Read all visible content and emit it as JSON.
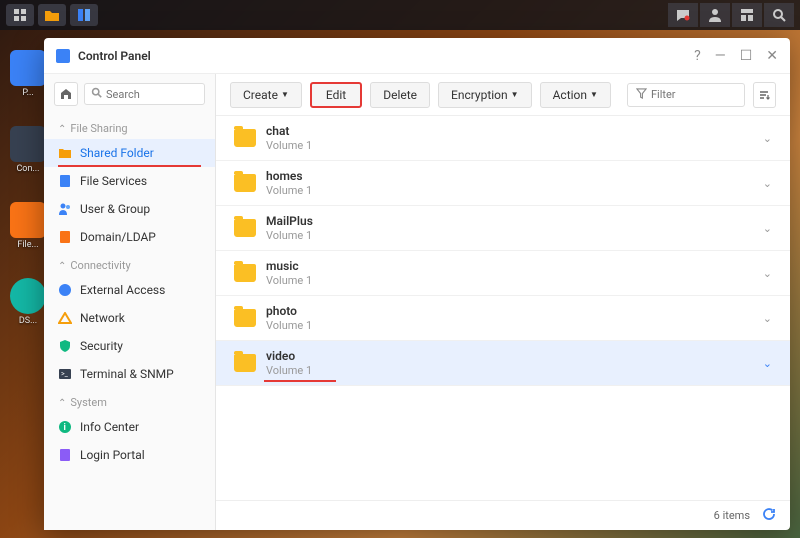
{
  "window": {
    "title": "Control Panel"
  },
  "search": {
    "placeholder": "Search"
  },
  "sidebar": {
    "sections": [
      {
        "label": "File Sharing"
      },
      {
        "label": "Connectivity"
      },
      {
        "label": "System"
      }
    ],
    "items": {
      "shared_folder": "Shared Folder",
      "file_services": "File Services",
      "user_group": "User & Group",
      "domain_ldap": "Domain/LDAP",
      "external_access": "External Access",
      "network": "Network",
      "security": "Security",
      "terminal_snmp": "Terminal & SNMP",
      "info_center": "Info Center",
      "login_portal": "Login Portal"
    }
  },
  "toolbar": {
    "create": "Create",
    "edit": "Edit",
    "delete": "Delete",
    "encryption": "Encryption",
    "action": "Action",
    "filter_placeholder": "Filter"
  },
  "folders": [
    {
      "name": "chat",
      "volume": "Volume 1"
    },
    {
      "name": "homes",
      "volume": "Volume 1"
    },
    {
      "name": "MailPlus",
      "volume": "Volume 1"
    },
    {
      "name": "music",
      "volume": "Volume 1"
    },
    {
      "name": "photo",
      "volume": "Volume 1"
    },
    {
      "name": "video",
      "volume": "Volume 1"
    }
  ],
  "status": {
    "count": "6 items"
  },
  "desktop": {
    "labels": [
      "P...",
      "Con...",
      "File...",
      "DS..."
    ]
  }
}
